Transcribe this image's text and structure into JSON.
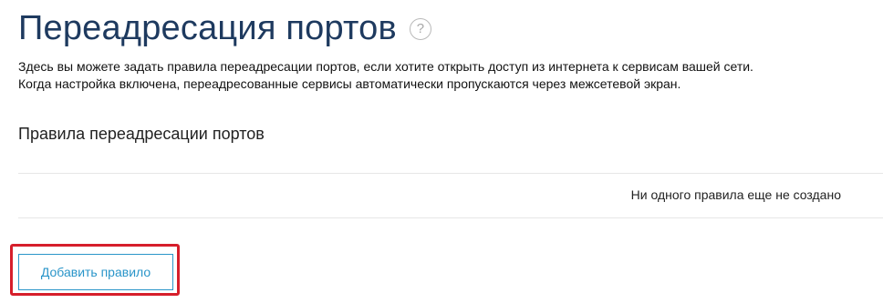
{
  "page": {
    "title": "Переадресация портов",
    "help_icon_glyph": "?",
    "description_line1": "Здесь вы можете задать правила переадресации портов, если хотите открыть доступ из интернета к сервисам вашей сети.",
    "description_line2": "Когда настройка включена, переадресованные сервисы автоматически пропускаются через межсетевой экран."
  },
  "rules_section": {
    "title": "Правила переадресации портов",
    "empty_message": "Ни одного правила еще не создано",
    "add_button_label": "Добавить правило"
  },
  "icons": {
    "help": "help-circle-icon"
  },
  "colors": {
    "title": "#1e3a5f",
    "accent": "#2a95c9",
    "highlight": "#d61e2b",
    "divider": "#e6e6e6"
  }
}
